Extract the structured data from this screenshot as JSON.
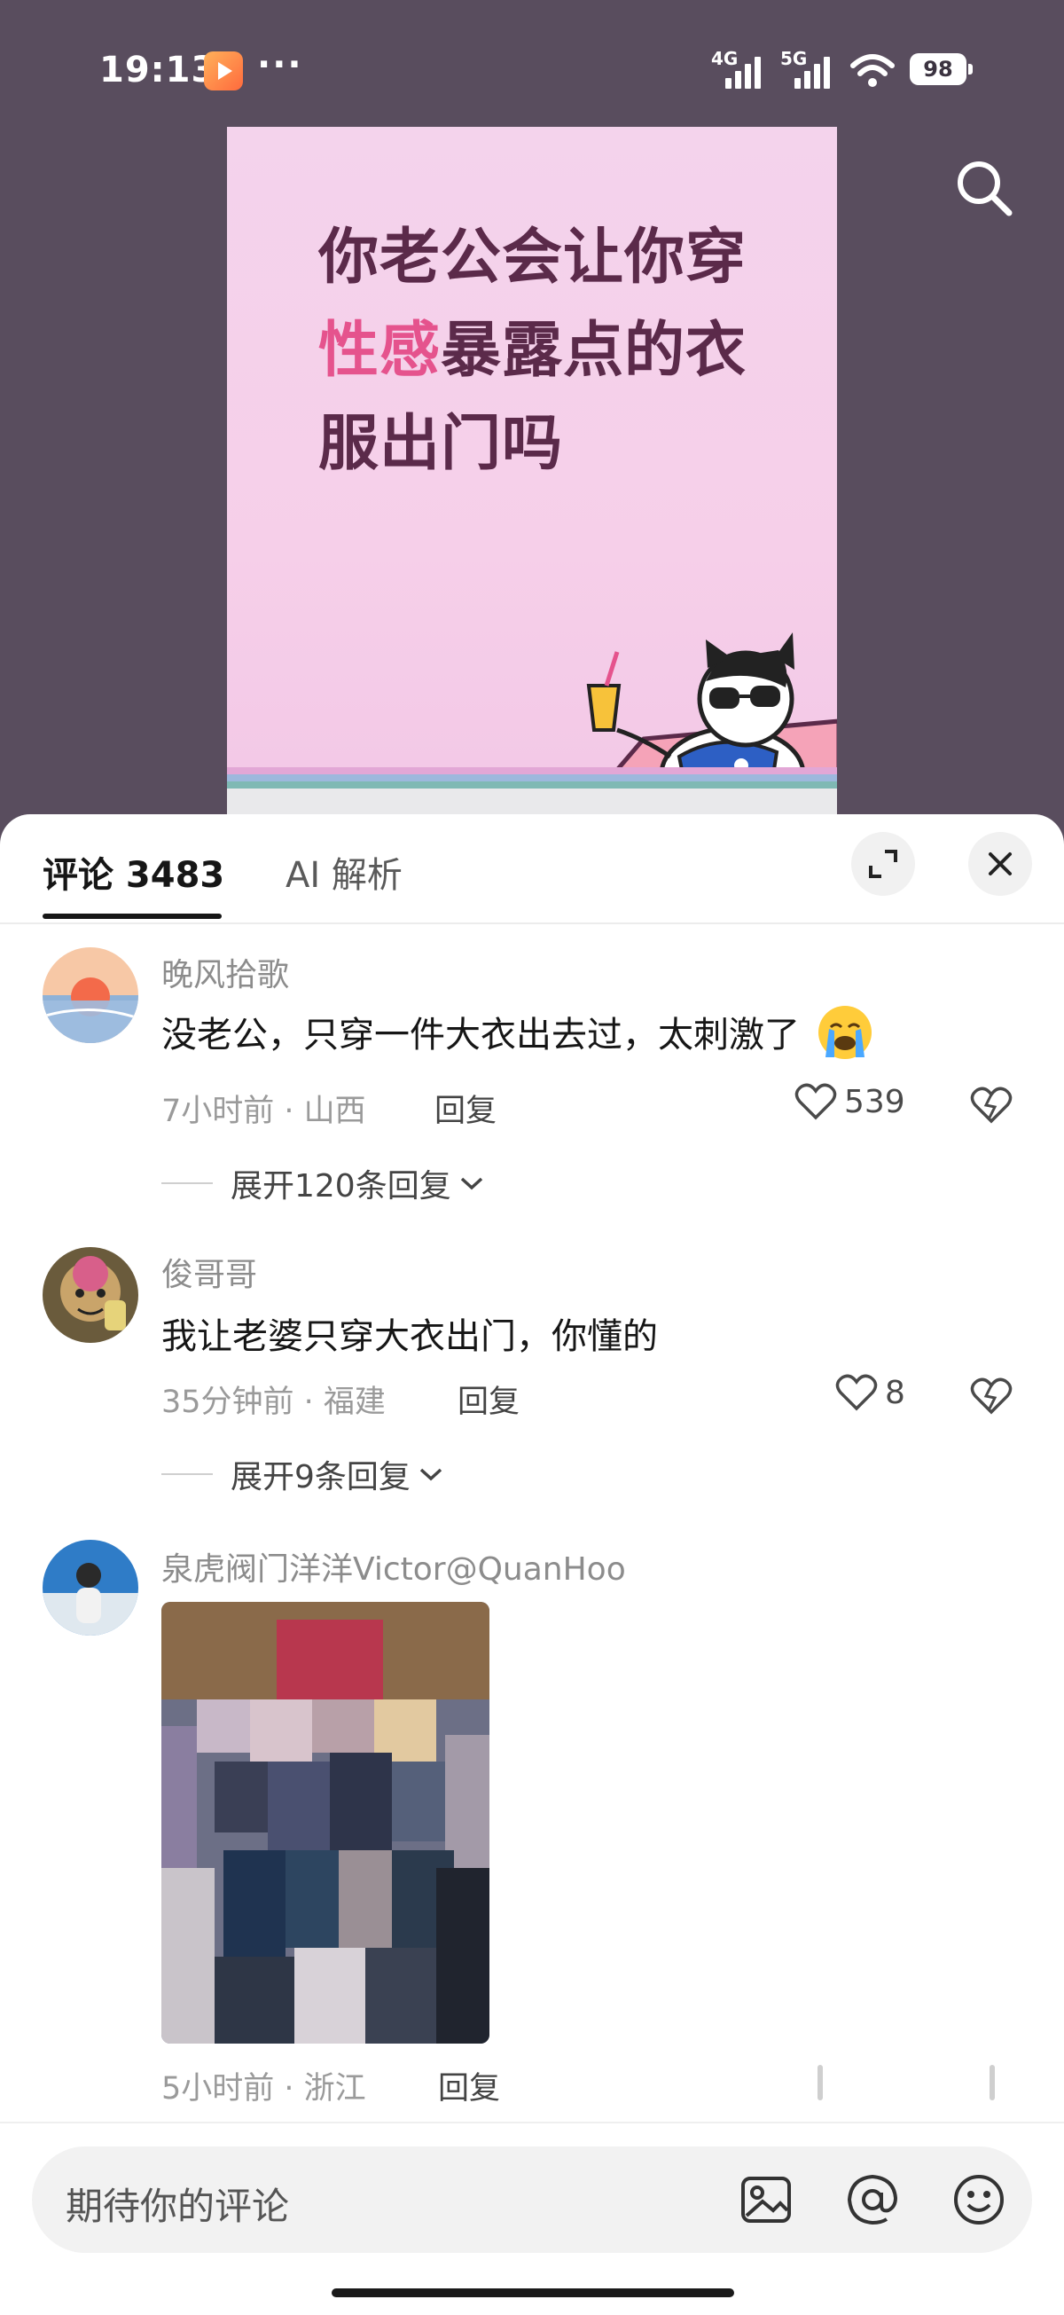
{
  "status_bar": {
    "time": "19:13",
    "dots": "···",
    "net1": "4G",
    "net2": "5G",
    "battery": "98"
  },
  "poster": {
    "line1": "你老公会让你穿",
    "line2_highlight": "性感",
    "line2_rest": "暴露点的衣",
    "line3": "服出门吗",
    "colors": {
      "background": "#f4d3ec",
      "title": "#5b2a4a",
      "highlight": "#e5538d"
    }
  },
  "sheet": {
    "tab_comments": "评论 3483",
    "tab_ai": "AI 解析"
  },
  "comments": [
    {
      "name": "晚风拾歌",
      "text": "没老公，只穿一件大衣出去过，太刺激了",
      "emoji": "loudly-crying-face",
      "meta": "7小时前 · 山西",
      "reply": "回复",
      "likes": "539",
      "expand": "展开120条回复"
    },
    {
      "name": "俊哥哥",
      "text": "我让老婆只穿大衣出门，你懂的",
      "meta": "35分钟前 · 福建",
      "reply": "回复",
      "likes": "8",
      "expand": "展开9条回复"
    },
    {
      "name": "泉虎阀门洋洋Victor@QuanHoo",
      "meta": "5小时前 · 浙江",
      "reply": "回复"
    }
  ],
  "input": {
    "placeholder": "期待你的评论"
  }
}
